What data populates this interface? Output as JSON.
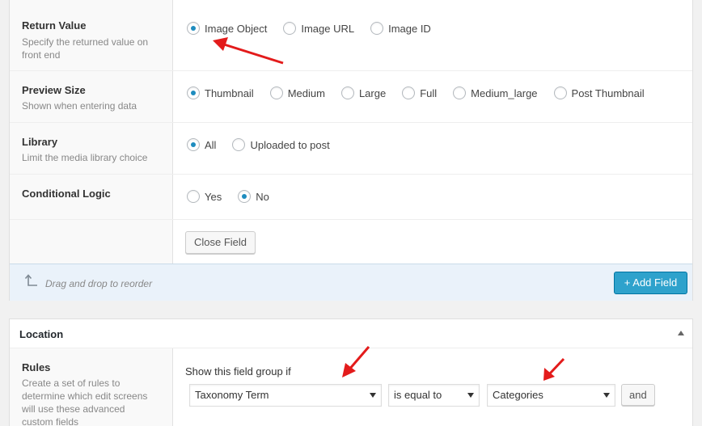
{
  "return_value": {
    "label": "Return Value",
    "desc": "Specify the returned value on front end",
    "options": [
      "Image Object",
      "Image URL",
      "Image ID"
    ],
    "selected": 0
  },
  "preview_size": {
    "label": "Preview Size",
    "desc": "Shown when entering data",
    "options": [
      "Thumbnail",
      "Medium",
      "Large",
      "Full",
      "Medium_large",
      "Post Thumbnail"
    ],
    "selected": 0
  },
  "library": {
    "label": "Library",
    "desc": "Limit the media library choice",
    "options": [
      "All",
      "Uploaded to post"
    ],
    "selected": 0
  },
  "conditional_logic": {
    "label": "Conditional Logic",
    "options": [
      "Yes",
      "No"
    ],
    "selected": 1
  },
  "close_field_label": "Close Field",
  "footer": {
    "drag_text": "Drag and drop to reorder",
    "add_field_label": "+ Add Field"
  },
  "location": {
    "title": "Location",
    "rules_label": "Rules",
    "rules_desc": "Create a set of rules to determine which edit screens will use these advanced custom fields",
    "show_if": "Show this field group if",
    "param": "Taxonomy Term",
    "operator": "is equal to",
    "value": "Categories",
    "and_label": "and"
  },
  "colors": {
    "accent": "#2ea2cc",
    "radio_dot": "#1e8cbe",
    "annotation_arrow": "#e31b1b"
  }
}
